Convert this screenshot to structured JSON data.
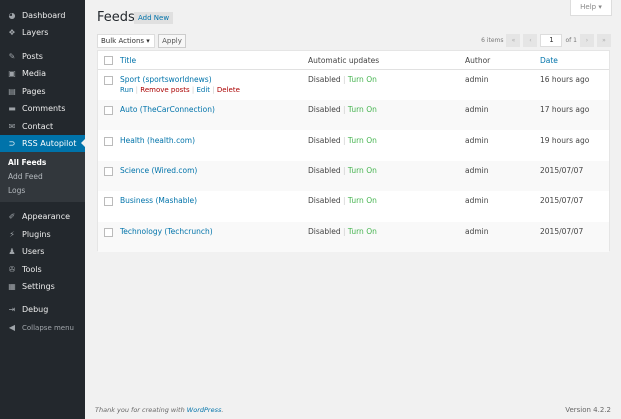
{
  "sidebar": {
    "items": [
      {
        "label": "Dashboard",
        "icon": "dashboard-icon",
        "glyph": "◕"
      },
      {
        "label": "Layers",
        "icon": "layers-icon",
        "glyph": "❖"
      },
      {
        "label": "Posts",
        "icon": "pin-icon",
        "glyph": "✎"
      },
      {
        "label": "Media",
        "icon": "media-icon",
        "glyph": "▣"
      },
      {
        "label": "Pages",
        "icon": "pages-icon",
        "glyph": "▤"
      },
      {
        "label": "Comments",
        "icon": "comments-icon",
        "glyph": "▬"
      },
      {
        "label": "Contact",
        "icon": "mail-icon",
        "glyph": "✉"
      },
      {
        "label": "RSS Autopilot",
        "icon": "rss-icon",
        "glyph": "⊃"
      },
      {
        "label": "Appearance",
        "icon": "brush-icon",
        "glyph": "✐"
      },
      {
        "label": "Plugins",
        "icon": "plugin-icon",
        "glyph": "⚡"
      },
      {
        "label": "Users",
        "icon": "user-icon",
        "glyph": "♟"
      },
      {
        "label": "Tools",
        "icon": "wrench-icon",
        "glyph": "✇"
      },
      {
        "label": "Settings",
        "icon": "settings-icon",
        "glyph": "▦"
      },
      {
        "label": "Debug",
        "icon": "debug-icon",
        "glyph": "⇥"
      }
    ],
    "submenu": [
      "All Feeds",
      "Add Feed",
      "Logs"
    ],
    "collapse": "Collapse menu"
  },
  "header": {
    "title": "Feeds",
    "add_new": "Add New",
    "help": "Help ▾"
  },
  "toolbar": {
    "bulk": "Bulk Actions ▾",
    "apply": "Apply",
    "items": "6 items",
    "first": "«",
    "prev": "‹",
    "page": "1",
    "of": "of 1",
    "next": "›",
    "last": "»"
  },
  "table": {
    "headers": [
      "Title",
      "Automatic updates",
      "Author",
      "Date"
    ],
    "row_actions": [
      "Run",
      "Remove posts",
      "Edit",
      "Delete"
    ],
    "status": "Disabled",
    "turn_on": "Turn On",
    "rows": [
      {
        "title": "Sport (sportsworldnews)",
        "author": "admin",
        "date": "16 hours ago"
      },
      {
        "title": "Auto (TheCarConnection)",
        "author": "admin",
        "date": "17 hours ago"
      },
      {
        "title": "Health (health.com)",
        "author": "admin",
        "date": "19 hours ago"
      },
      {
        "title": "Science (Wired.com)",
        "author": "admin",
        "date": "2015/07/07"
      },
      {
        "title": "Business (Mashable)",
        "author": "admin",
        "date": "2015/07/07"
      },
      {
        "title": "Technology (Techcrunch)",
        "author": "admin",
        "date": "2015/07/07"
      }
    ]
  },
  "footer": {
    "thanks": "Thank you for creating with ",
    "wp": "WordPress",
    "dot": ".",
    "version": "Version 4.2.2"
  },
  "colors": {
    "accent": "#0073aa",
    "sidebar": "#23282d",
    "green": "#46b450",
    "red": "#a00"
  }
}
